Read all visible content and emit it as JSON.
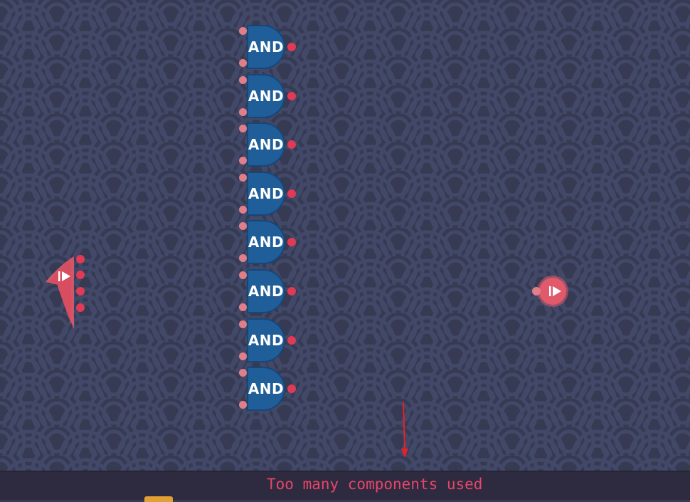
{
  "status_bar": {
    "message": "Too many components used"
  },
  "gates": [
    {
      "type": "AND"
    },
    {
      "type": "AND"
    },
    {
      "type": "AND"
    },
    {
      "type": "AND"
    },
    {
      "type": "AND"
    },
    {
      "type": "AND"
    },
    {
      "type": "AND"
    },
    {
      "type": "AND"
    }
  ],
  "input_component": {
    "icon": "play-icon",
    "output_pins": 4
  },
  "output_component": {
    "icon": "play-icon",
    "input_pins": 1
  },
  "colors": {
    "background": "#363a52",
    "wave_pattern": "#424868",
    "gate_fill": "#1f5e99",
    "pin_input": "#e07f8a",
    "pin_output": "#e03a55",
    "io_component": "#e05a6b",
    "error_text": "#e8456a",
    "arrow": "#e8202a"
  }
}
